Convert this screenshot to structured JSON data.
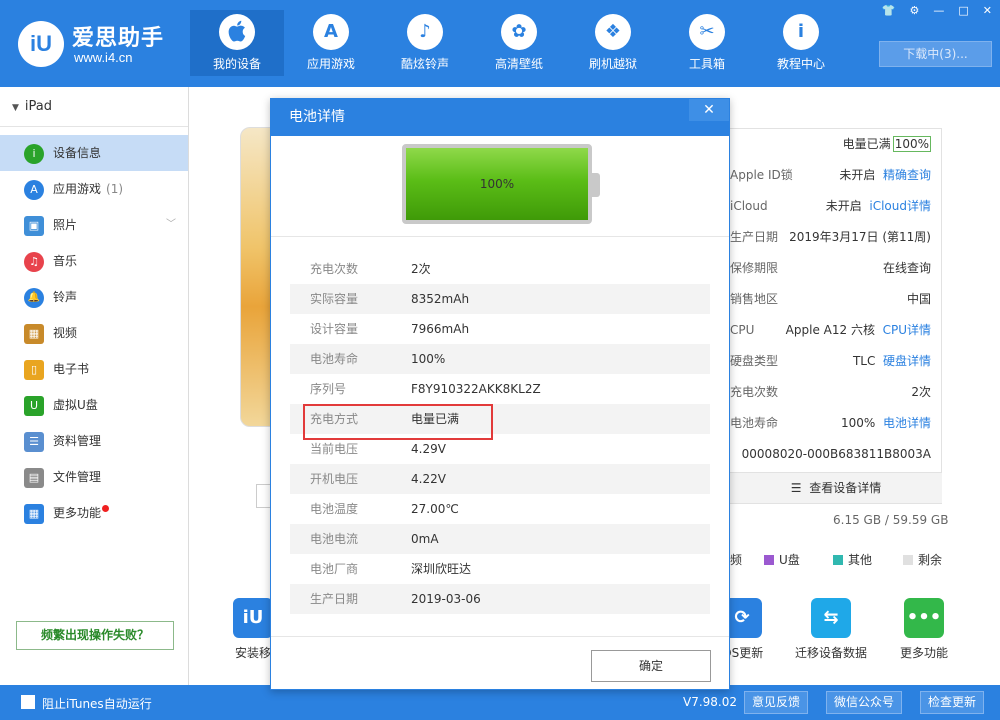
{
  "header": {
    "logo_mark": "iU",
    "app_name": "爱思助手",
    "app_url": "www.i4.cn",
    "nav": [
      {
        "label": "我的设备",
        "icon": ""
      },
      {
        "label": "应用游戏",
        "icon": "A"
      },
      {
        "label": "酷炫铃声",
        "icon": "♪"
      },
      {
        "label": "高清壁纸",
        "icon": "✿"
      },
      {
        "label": "刷机越狱",
        "icon": "❖"
      },
      {
        "label": "工具箱",
        "icon": "✂"
      },
      {
        "label": "教程中心",
        "icon": "i"
      }
    ],
    "download_label": "下载中(3)...",
    "win_controls": [
      "👕",
      "⚙",
      "—",
      "□",
      "✕"
    ]
  },
  "sidebar": {
    "device": "iPad",
    "items": [
      {
        "label": "设备信息",
        "count": "",
        "icon": "i",
        "color": "#2aa32a"
      },
      {
        "label": "应用游戏",
        "count": "(1)",
        "icon": "A",
        "color": "#2b81e0"
      },
      {
        "label": "照片",
        "count": "",
        "icon": "▣",
        "color": "#3f8fd8"
      },
      {
        "label": "音乐",
        "count": "",
        "icon": "♫",
        "color": "#e8434c"
      },
      {
        "label": "铃声",
        "count": "",
        "icon": "🔔",
        "color": "#2b81e0"
      },
      {
        "label": "视频",
        "count": "",
        "icon": "▦",
        "color": "#c88a2a"
      },
      {
        "label": "电子书",
        "count": "",
        "icon": "▯",
        "color": "#e9a520"
      },
      {
        "label": "虚拟U盘",
        "count": "",
        "icon": "U",
        "color": "#2aa32a"
      },
      {
        "label": "资料管理",
        "count": "",
        "icon": "☰",
        "color": "#5a8fd0"
      },
      {
        "label": "文件管理",
        "count": "",
        "icon": "▤",
        "color": "#8a8a8a"
      },
      {
        "label": "更多功能",
        "count": "",
        "icon": "▦",
        "color": "#2b81e0"
      }
    ],
    "freq_button": "频繁出现操作失败？"
  },
  "info_panel": {
    "charge_status": "电量已满",
    "charge_badge": "100%",
    "rows": [
      {
        "label": "Apple ID锁",
        "value": "未开启",
        "link": "精确查询"
      },
      {
        "label": "iCloud",
        "value": "未开启",
        "link": "iCloud详情"
      },
      {
        "label": "生产日期",
        "value": "2019年3月17日 (第11周)",
        "link": ""
      },
      {
        "label": "保修期限",
        "value": "",
        "link": "在线查询"
      },
      {
        "label": "销售地区",
        "value": "中国",
        "link": ""
      },
      {
        "label": "CPU",
        "value": "Apple A12 六核",
        "link": "CPU详情"
      },
      {
        "label": "硬盘类型",
        "value": "TLC",
        "link": "硬盘详情"
      },
      {
        "label": "充电次数",
        "value": "2次",
        "link": ""
      },
      {
        "label": "电池寿命",
        "value": "100%",
        "link": "电池详情"
      },
      {
        "label": "",
        "value": "00008020-000B683811B8003A",
        "link": ""
      }
    ],
    "detail_button": "查看设备详情",
    "storage": "6.15 GB / 59.59 GB",
    "legend": [
      {
        "label": "频",
        "color": "#f0a030"
      },
      {
        "label": "U盘",
        "color": "#9b59d0"
      },
      {
        "label": "其他",
        "color": "#30b8b0"
      },
      {
        "label": "剩余",
        "color": "#e0e0e0"
      }
    ]
  },
  "tools": [
    {
      "label": "安装移",
      "icon": "iU",
      "color": "#2b81e0"
    },
    {
      "label": "iOS更新",
      "icon": "⟳",
      "color": "#2b81e0"
    },
    {
      "label": "迁移设备数据",
      "icon": "⇆",
      "color": "#1fa8e8"
    },
    {
      "label": "更多功能",
      "icon": "•••",
      "color": "#33b84a"
    }
  ],
  "statusbar": {
    "stop_itunes": "阻止iTunes自动运行",
    "version": "V7.98.02",
    "buttons": [
      "意见反馈",
      "微信公众号",
      "检查更新"
    ]
  },
  "modal": {
    "title": "电池详情",
    "close": "✕",
    "battery_percent": 100,
    "battery_label": "100%",
    "rows": [
      {
        "key": "充电次数",
        "value": "2次"
      },
      {
        "key": "实际容量",
        "value": "8352mAh"
      },
      {
        "key": "设计容量",
        "value": "7966mAh"
      },
      {
        "key": "电池寿命",
        "value": "100%"
      },
      {
        "key": "序列号",
        "value": "F8Y910322AKK8KL2Z"
      },
      {
        "key": "充电方式",
        "value": "电量已满"
      },
      {
        "key": "当前电压",
        "value": "4.29V"
      },
      {
        "key": "开机电压",
        "value": "4.22V"
      },
      {
        "key": "电池温度",
        "value": "27.00℃"
      },
      {
        "key": "电池电流",
        "value": "0mA"
      },
      {
        "key": "电池厂商",
        "value": "深圳欣旺达"
      },
      {
        "key": "生产日期",
        "value": "2019-03-06"
      }
    ],
    "ok_button": "确定"
  }
}
